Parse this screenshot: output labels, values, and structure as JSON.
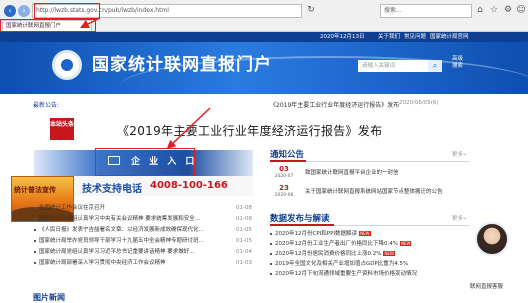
{
  "browser": {
    "url": "http://lwzb.stats.gov.cn/pub/lwzb/index.html",
    "search_placeholder": "搜索...",
    "tab_label": "国家统计联网直报门户"
  },
  "topbar": {
    "date": "2020年12月13日",
    "links": [
      "关于我们",
      "常见问题",
      "国家统计局官网"
    ]
  },
  "header": {
    "title": "国家统计联网直报门户",
    "search_placeholder": "请输入关键词",
    "advanced_search": "高级搜索"
  },
  "notice": {
    "label": "最新公告:",
    "text": "《2019年主要工业行业年度经济运行报告》发布",
    "date": "2020/06/05(6)"
  },
  "headline": {
    "tag": "本站头条",
    "text": "《2019年主要工业行业年度经济运行报告》发布"
  },
  "entry": {
    "label": "企 业 入 口",
    "support_label": "技术支持电话",
    "support_phone": "4008-100-166"
  },
  "promo": {
    "text": "统计普法宣传"
  },
  "left_news": [
    {
      "title": "全国统计工作会议在京召开",
      "date": "01-08"
    },
    {
      "title": "国家统计局党组认真学习中央有关会议精神 要求统筹发展和安全...",
      "date": "01-08"
    },
    {
      "title": "《人民日报》发表宁吉喆署名文章：以经济发展新成效确保现代化...",
      "date": "01-05"
    },
    {
      "title": "国家统计局举办党员领导干部学习十九届五中全会精神专题研讨班...",
      "date": "01-05"
    },
    {
      "title": "国家统计局党组认真学习习近平总书记重要讲话精神 要求做好...",
      "date": "01-04"
    },
    {
      "title": "国家统计局部署深入学习贯彻中央经济工作会议精神",
      "date": "01-03"
    }
  ],
  "pic_news_title": "图片新闻",
  "announcements": {
    "title": "通知公告",
    "more": "更多»",
    "items": [
      {
        "day": "03",
        "month": "2020-07",
        "text": "致国家统计联网直报平台企业的一封信"
      },
      {
        "day": "23",
        "month": "2020-06",
        "text": "关于国家统计联网直报系统网站国家节点整体搬迁的公告"
      }
    ]
  },
  "data_release": {
    "title": "数据发布与解读",
    "more": "更多»",
    "items": [
      {
        "text": "2020年12月份CPI和PPI数据解读",
        "new": true
      },
      {
        "text": "2020年12月份工业生产者出厂价格同比下降0.4%",
        "new": true
      },
      {
        "text": "2020年12月份居民消费价格同比上涨0.2%",
        "new": true
      },
      {
        "text": "2019年全国文化及相关产业增加值占GDP比重为4.5%",
        "new": false
      },
      {
        "text": "2020年12月下旬流通领域重要生产资料市场价格变动情况",
        "new": false
      }
    ],
    "new_badge": "NEW"
  },
  "customer_service": {
    "label": "联网直报客服"
  },
  "colors": {
    "brand_blue": "#0f3f92",
    "accent_red": "#c8161d",
    "highlight_red": "#e02020"
  }
}
